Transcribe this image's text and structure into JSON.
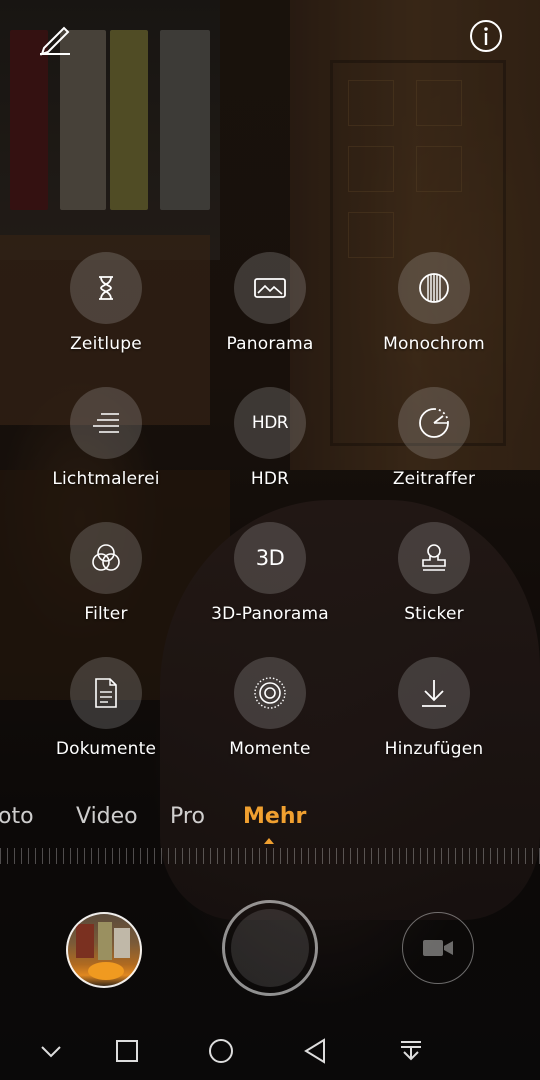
{
  "top_bar": {
    "edit_icon": "pencil-icon",
    "info_icon": "info-icon"
  },
  "modes": [
    {
      "label": "Zeitlupe",
      "icon": "hourglass-icon"
    },
    {
      "label": "Panorama",
      "icon": "panorama-icon"
    },
    {
      "label": "Monochrom",
      "icon": "monochrome-icon"
    },
    {
      "label": "Lichtmalerei",
      "icon": "light-painting-icon"
    },
    {
      "label": "HDR",
      "icon": "hdr-icon",
      "icon_text": "HDR"
    },
    {
      "label": "Zeitraffer",
      "icon": "timelapse-icon"
    },
    {
      "label": "Filter",
      "icon": "filter-icon"
    },
    {
      "label": "3D-Panorama",
      "icon": "3d-icon",
      "icon_text": "3D"
    },
    {
      "label": "Sticker",
      "icon": "sticker-icon"
    },
    {
      "label": "Dokumente",
      "icon": "document-icon"
    },
    {
      "label": "Momente",
      "icon": "moments-icon"
    },
    {
      "label": "Hinzufügen",
      "icon": "download-icon"
    }
  ],
  "camera_tabs": [
    "oto",
    "Video",
    "Pro",
    "Mehr"
  ],
  "active_tab": "Mehr",
  "accent_color": "#f0a030",
  "bottom_controls": {
    "gallery": "gallery-thumbnail",
    "shutter": "shutter-button",
    "video": "video-camera-icon"
  },
  "navigation": [
    "chevron-down-icon",
    "recents-square-icon",
    "home-circle-icon",
    "back-triangle-icon",
    "notification-pull-icon"
  ]
}
